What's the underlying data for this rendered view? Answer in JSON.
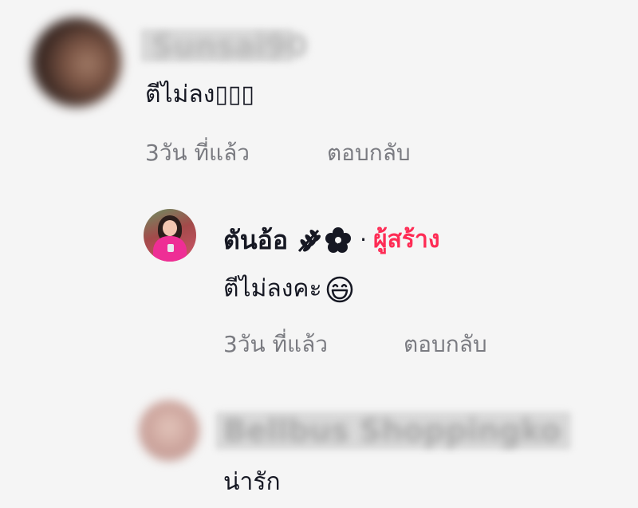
{
  "comments": [
    {
      "username": "Sunsai90",
      "text": "ตีไม่ลง▯▯▯",
      "time": "3วัน ที่แล้ว",
      "reply_label": "ตอบกลับ"
    },
    {
      "username": "ตันอ้อ",
      "creator_tag": "ผู้สร้าง",
      "separator": "·",
      "text": "ตีไม่ลงคะ",
      "emoji": "grinning-face-icon",
      "time": "3วัน ที่แล้ว",
      "reply_label": "ตอบกลับ"
    },
    {
      "username": "Bellbus Shoppingko",
      "text": "น่ารัก"
    }
  ],
  "colors": {
    "background": "#f5f5f5",
    "text": "#161823",
    "meta": "#7a7b81",
    "creator_accent": "#fe2c55"
  }
}
